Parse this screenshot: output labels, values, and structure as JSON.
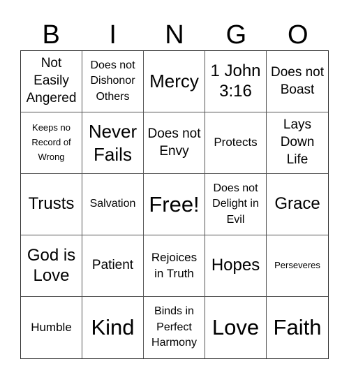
{
  "header": {
    "letters": [
      "B",
      "I",
      "N",
      "G",
      "O"
    ]
  },
  "board": {
    "rows": [
      [
        "Not Easily Angered",
        "Does not Dishonor Others",
        "Mercy",
        "1 John 3:16",
        "Does not Boast"
      ],
      [
        "Keeps no Record of Wrong",
        "Never Fails",
        "Does not Envy",
        "Protects",
        "Lays Down Life"
      ],
      [
        "Trusts",
        "Salvation",
        "Free!",
        "Does not Delight in Evil",
        "Grace"
      ],
      [
        "God is Love",
        "Patient",
        "Rejoices in Truth",
        "Hopes",
        "Perseveres"
      ],
      [
        "Humble",
        "Kind",
        "Binds in Perfect Harmony",
        "Love",
        "Faith"
      ]
    ]
  }
}
